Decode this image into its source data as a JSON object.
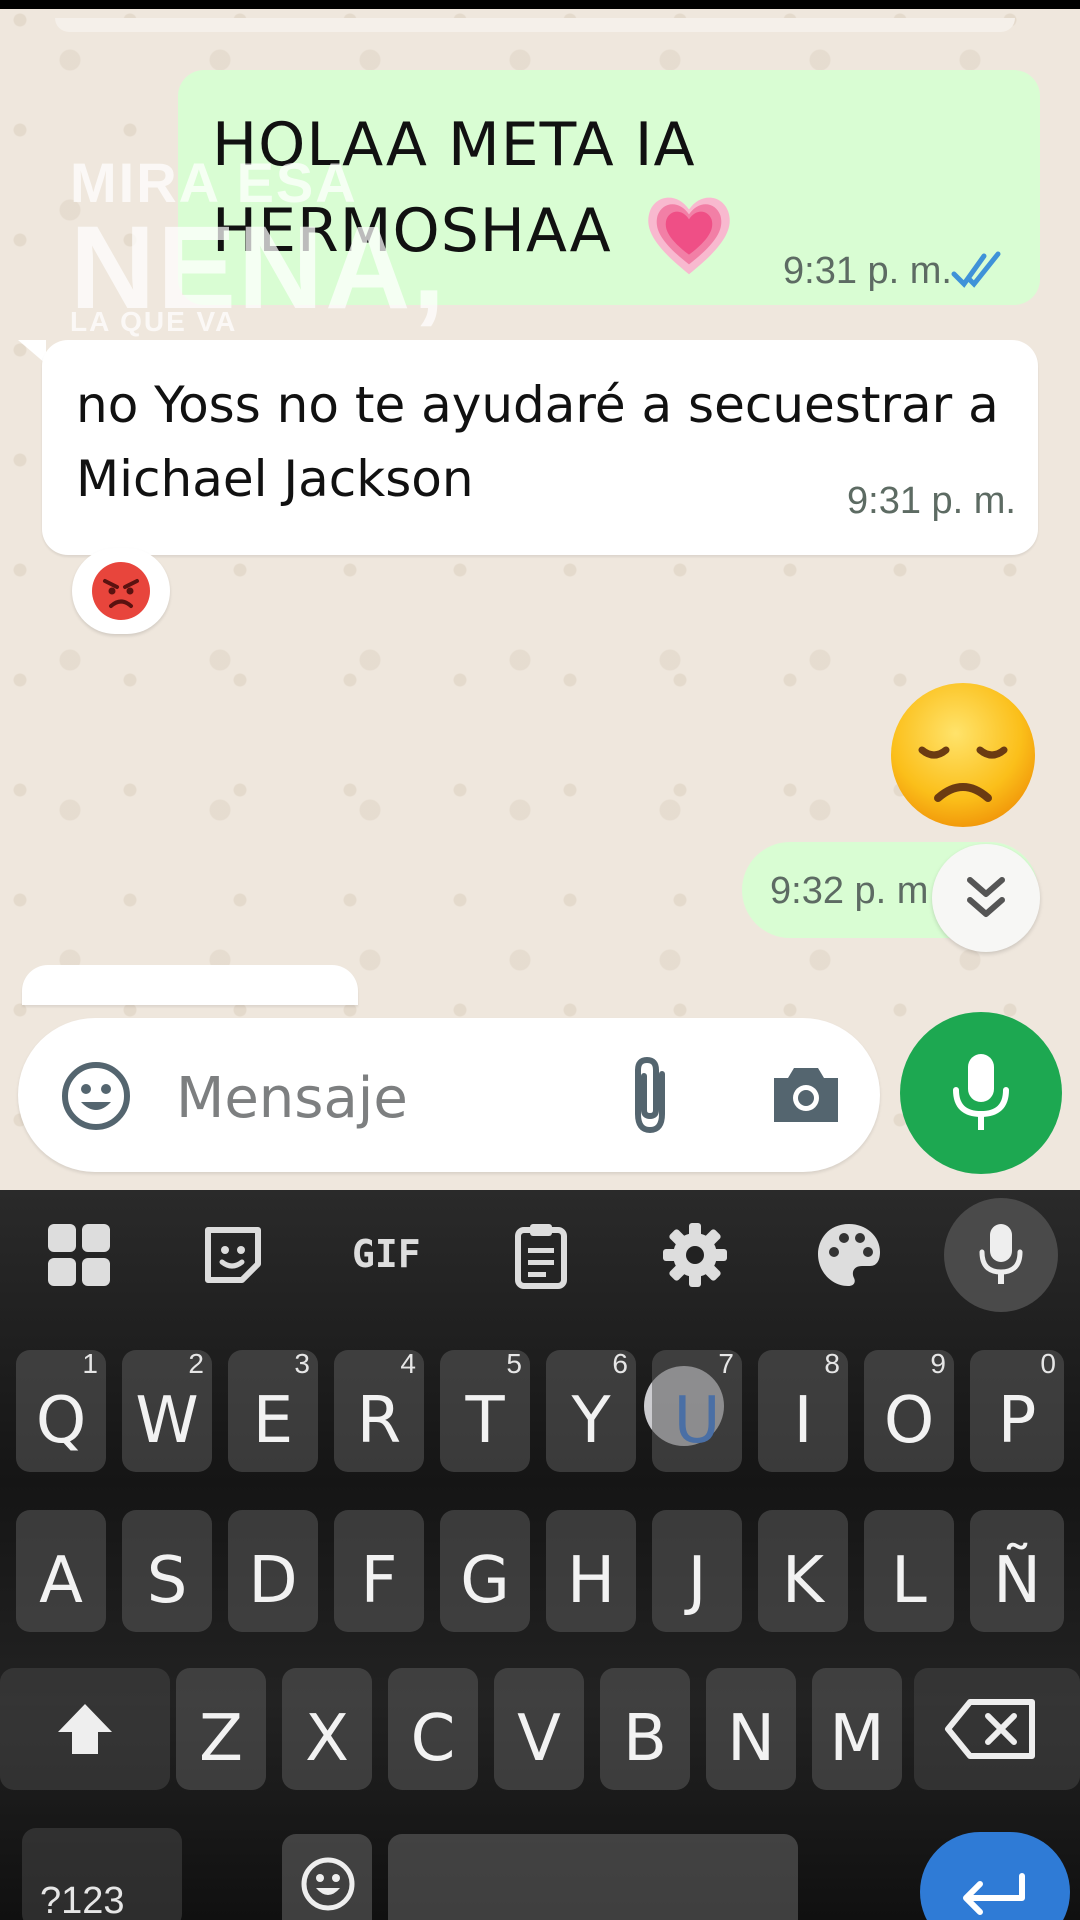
{
  "colors": {
    "outgoing_bubble": "#d9fdd3",
    "incoming_bubble": "#ffffff",
    "read_ticks": "#3f92d8",
    "mic_button": "#1da851",
    "enter_key": "#2f7bd6"
  },
  "watermark": {
    "line1": "MIRA ESA",
    "line2": "NENA,",
    "line3": "LA QUE VA"
  },
  "messages": [
    {
      "direction": "outgoing",
      "text": "HOLAA META IA HERMOSHAA",
      "emoji": "growing-heart",
      "time": "9:31 p. m.",
      "status_icon": "double-check-read-icon"
    },
    {
      "direction": "incoming",
      "text": "no Yoss no te ayudaré a secuestrar a Michael Jackson",
      "time": "9:31 p. m.",
      "reaction": "angry-face"
    },
    {
      "direction": "outgoing",
      "emoji": "disappointed-face",
      "time": "9:32 p. m"
    }
  ],
  "composer": {
    "placeholder": "Mensaje",
    "icons": [
      "emoji-icon",
      "attach-icon",
      "camera-icon",
      "mic-icon"
    ]
  },
  "keyboard": {
    "toolbar": [
      "apps-grid-icon",
      "sticker-icon",
      "GIF",
      "clipboard-icon",
      "settings-icon",
      "palette-icon",
      "mic-icon"
    ],
    "gif_label": "GIF",
    "row1": [
      {
        "key": "Q",
        "num": "1"
      },
      {
        "key": "W",
        "num": "2"
      },
      {
        "key": "E",
        "num": "3"
      },
      {
        "key": "R",
        "num": "4"
      },
      {
        "key": "T",
        "num": "5"
      },
      {
        "key": "Y",
        "num": "6"
      },
      {
        "key": "U",
        "num": "7"
      },
      {
        "key": "I",
        "num": "8"
      },
      {
        "key": "O",
        "num": "9"
      },
      {
        "key": "P",
        "num": "0"
      }
    ],
    "row2": [
      "A",
      "S",
      "D",
      "F",
      "G",
      "H",
      "J",
      "K",
      "L",
      "Ñ"
    ],
    "row3": [
      "Z",
      "X",
      "C",
      "V",
      "B",
      "N",
      "M"
    ],
    "pressed_key": "U",
    "symbols_label": "?123"
  }
}
